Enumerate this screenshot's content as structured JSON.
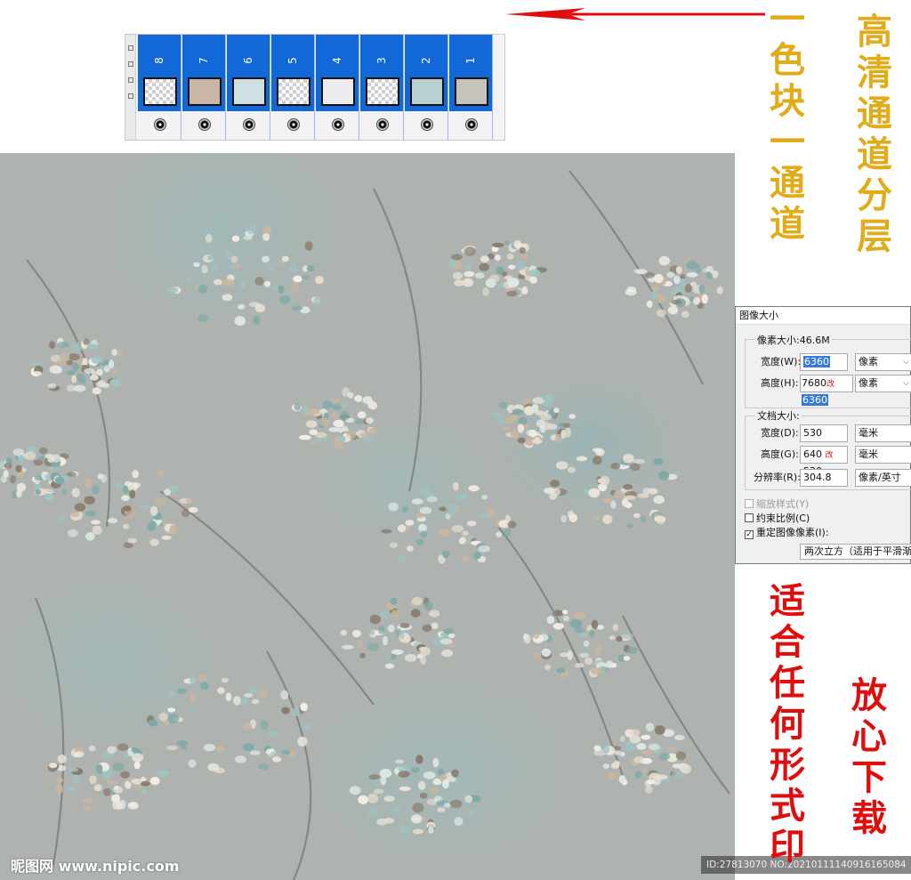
{
  "colors": {
    "gold_text": "#e0ac1a",
    "red_text": "#e00d0d",
    "channel_blue": "#1168d6",
    "pattern_base": "#aeb3b0",
    "pattern_teal": "#8fb6b8",
    "flower_white": "#f3efe8"
  },
  "channels": {
    "numbers": [
      "8",
      "7",
      "6",
      "5",
      "4",
      "3",
      "2",
      "1"
    ],
    "eye_icon": "eye-icon"
  },
  "headline": {
    "gold_col1": "一色块一通道",
    "gold_col2": "高清通道分层",
    "red_col1": "适合任何形式印",
    "red_col2": "放心下载"
  },
  "dialog": {
    "title": "图像大小",
    "pixel_size_label": "像素大小:46.6M",
    "width_label": "宽度(W):",
    "width_value": "6360",
    "height_label": "高度(H):",
    "height_value_old": "7680",
    "height_mark": "改",
    "height_value_new": "6360",
    "pixel_unit": "像素",
    "doc_size_label": "文档大小:",
    "doc_width_label": "宽度(D):",
    "doc_width_value": "530",
    "doc_height_label": "高度(G):",
    "doc_height_value_old": "640",
    "doc_height_mark": "改",
    "doc_height_value_new": "530",
    "mm_unit": "毫米",
    "resolution_label": "分辨率(R):",
    "resolution_value": "304.8",
    "resolution_unit": "像素/英寸",
    "scale_styles": "缩放样式(Y)",
    "constrain": "约束比例(C)",
    "resample": "重定图像像素(I):",
    "resample_method": "两次立方（适用于平滑渐变"
  },
  "watermark": {
    "left": "昵图网 www.nipic.com",
    "right": "ID:27813070 NO:20210111140916165084"
  }
}
